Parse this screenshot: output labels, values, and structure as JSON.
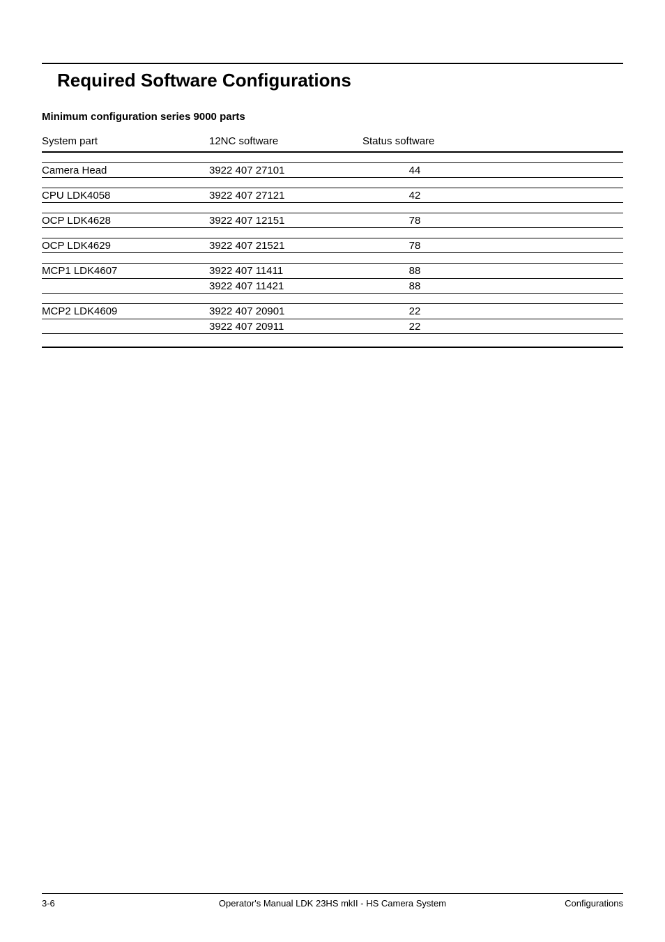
{
  "title": "Required  Software  Configurations",
  "subhead": "Minimum configuration series 9000 parts",
  "headers": {
    "col1": "System part",
    "col2": "12NC software",
    "col3": "Status software"
  },
  "groups": [
    {
      "rows": [
        {
          "part": "Camera Head",
          "code": "3922 407 27101",
          "status": "44"
        }
      ]
    },
    {
      "rows": [
        {
          "part": "CPU LDK4058",
          "code": "3922 407 27121",
          "status": "42"
        }
      ]
    },
    {
      "rows": [
        {
          "part": "OCP LDK4628",
          "code": "3922 407 12151",
          "status": "78"
        }
      ]
    },
    {
      "rows": [
        {
          "part": "OCP LDK4629",
          "code": "3922 407 21521",
          "status": "78"
        }
      ]
    },
    {
      "rows": [
        {
          "part": "MCP1 LDK4607",
          "code": "3922 407 11411",
          "status": "88"
        },
        {
          "part": "",
          "code": "3922 407 11421",
          "status": "88"
        }
      ]
    },
    {
      "rows": [
        {
          "part": "MCP2 LDK4609",
          "code": "3922 407 20901",
          "status": "22"
        },
        {
          "part": "",
          "code": "3922 407 20911",
          "status": "22"
        }
      ]
    }
  ],
  "footer": {
    "left": "3-6",
    "center": "Operator's Manual LDK 23HS mkII - HS Camera System",
    "right": "Configurations"
  }
}
